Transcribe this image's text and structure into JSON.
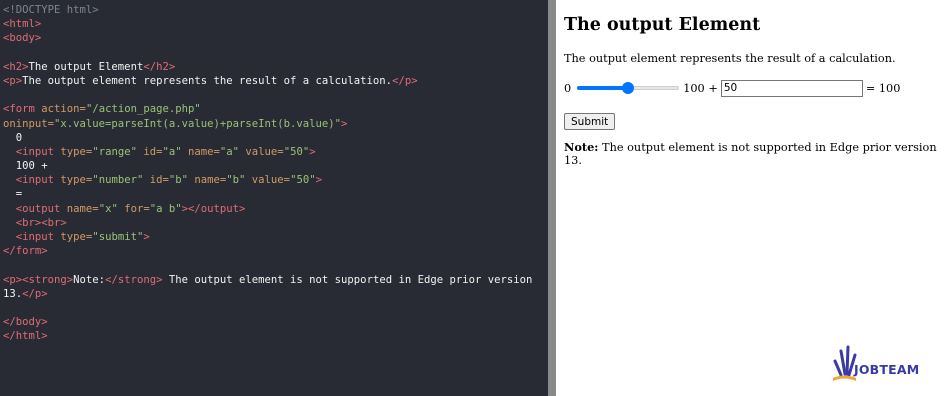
{
  "editor": {
    "lines": [
      [
        {
          "t": "<!DOCTYPE html>",
          "c": "com"
        }
      ],
      [
        {
          "t": "<html>",
          "c": "tag"
        }
      ],
      [
        {
          "t": "<body>",
          "c": "tag"
        }
      ],
      [
        {
          "t": "",
          "c": "txt"
        }
      ],
      [
        {
          "t": "<h2>",
          "c": "tag"
        },
        {
          "t": "The output Element",
          "c": "txt"
        },
        {
          "t": "</h2>",
          "c": "tag"
        }
      ],
      [
        {
          "t": "<p>",
          "c": "tag"
        },
        {
          "t": "The output element represents the result of a calculation.",
          "c": "txt"
        },
        {
          "t": "</p>",
          "c": "tag"
        }
      ],
      [
        {
          "t": "",
          "c": "txt"
        }
      ],
      [
        {
          "t": "<form ",
          "c": "tag"
        },
        {
          "t": "action=",
          "c": "attr"
        },
        {
          "t": "\"/action_page.php\"",
          "c": "val"
        }
      ],
      [
        {
          "t": "oninput=",
          "c": "attr"
        },
        {
          "t": "\"x.value=parseInt(a.value)+parseInt(b.value)\"",
          "c": "val"
        },
        {
          "t": ">",
          "c": "tag"
        }
      ],
      [
        {
          "t": "  0",
          "c": "txt"
        }
      ],
      [
        {
          "t": "  ",
          "c": "txt"
        },
        {
          "t": "<input ",
          "c": "tag"
        },
        {
          "t": "type=",
          "c": "attr"
        },
        {
          "t": "\"range\" ",
          "c": "val"
        },
        {
          "t": "id=",
          "c": "attr"
        },
        {
          "t": "\"a\" ",
          "c": "val"
        },
        {
          "t": "name=",
          "c": "attr"
        },
        {
          "t": "\"a\" ",
          "c": "val"
        },
        {
          "t": "value=",
          "c": "attr"
        },
        {
          "t": "\"50\"",
          "c": "val"
        },
        {
          "t": ">",
          "c": "tag"
        }
      ],
      [
        {
          "t": "  100 +",
          "c": "txt"
        }
      ],
      [
        {
          "t": "  ",
          "c": "txt"
        },
        {
          "t": "<input ",
          "c": "tag"
        },
        {
          "t": "type=",
          "c": "attr"
        },
        {
          "t": "\"number\" ",
          "c": "val"
        },
        {
          "t": "id=",
          "c": "attr"
        },
        {
          "t": "\"b\" ",
          "c": "val"
        },
        {
          "t": "name=",
          "c": "attr"
        },
        {
          "t": "\"b\" ",
          "c": "val"
        },
        {
          "t": "value=",
          "c": "attr"
        },
        {
          "t": "\"50\"",
          "c": "val"
        },
        {
          "t": ">",
          "c": "tag"
        }
      ],
      [
        {
          "t": "  =",
          "c": "txt"
        }
      ],
      [
        {
          "t": "  ",
          "c": "txt"
        },
        {
          "t": "<output ",
          "c": "tag"
        },
        {
          "t": "name=",
          "c": "attr"
        },
        {
          "t": "\"x\" ",
          "c": "val"
        },
        {
          "t": "for=",
          "c": "attr"
        },
        {
          "t": "\"a b\"",
          "c": "val"
        },
        {
          "t": "></output>",
          "c": "tag"
        }
      ],
      [
        {
          "t": "  ",
          "c": "txt"
        },
        {
          "t": "<br><br>",
          "c": "tag"
        }
      ],
      [
        {
          "t": "  ",
          "c": "txt"
        },
        {
          "t": "<input ",
          "c": "tag"
        },
        {
          "t": "type=",
          "c": "attr"
        },
        {
          "t": "\"submit\"",
          "c": "val"
        },
        {
          "t": ">",
          "c": "tag"
        }
      ],
      [
        {
          "t": "</form>",
          "c": "tag"
        }
      ],
      [
        {
          "t": "",
          "c": "txt"
        }
      ],
      [
        {
          "t": "<p><strong>",
          "c": "tag"
        },
        {
          "t": "Note:",
          "c": "txt"
        },
        {
          "t": "</strong>",
          "c": "tag"
        },
        {
          "t": " The output element is not supported in Edge prior version",
          "c": "txt"
        }
      ],
      [
        {
          "t": "13.",
          "c": "txt"
        },
        {
          "t": "</p>",
          "c": "tag"
        }
      ],
      [
        {
          "t": "",
          "c": "txt"
        }
      ],
      [
        {
          "t": "</body>",
          "c": "tag"
        }
      ],
      [
        {
          "t": "</html>",
          "c": "tag"
        }
      ]
    ]
  },
  "preview": {
    "heading": "The output Element",
    "description": "The output element represents the result of a calculation.",
    "calc": {
      "min_label": "0",
      "range_value_fraction": 0.5,
      "max_label": "100 +",
      "number_value": "50",
      "result": "= 100"
    },
    "submit_label": "Submit",
    "note_strong": "Note:",
    "note_text": " The output element is not supported in Edge prior version 13."
  },
  "logo": {
    "text": "JOBTEAM",
    "colors": {
      "primary": "#3a3aa6",
      "accent": "#f2a33a"
    }
  },
  "colors": {
    "editor_bg": "#282b33",
    "tag": "#e06c75",
    "attr": "#d19a66",
    "value": "#98c379",
    "comment": "#7f848e",
    "slider": "#0075ff"
  }
}
